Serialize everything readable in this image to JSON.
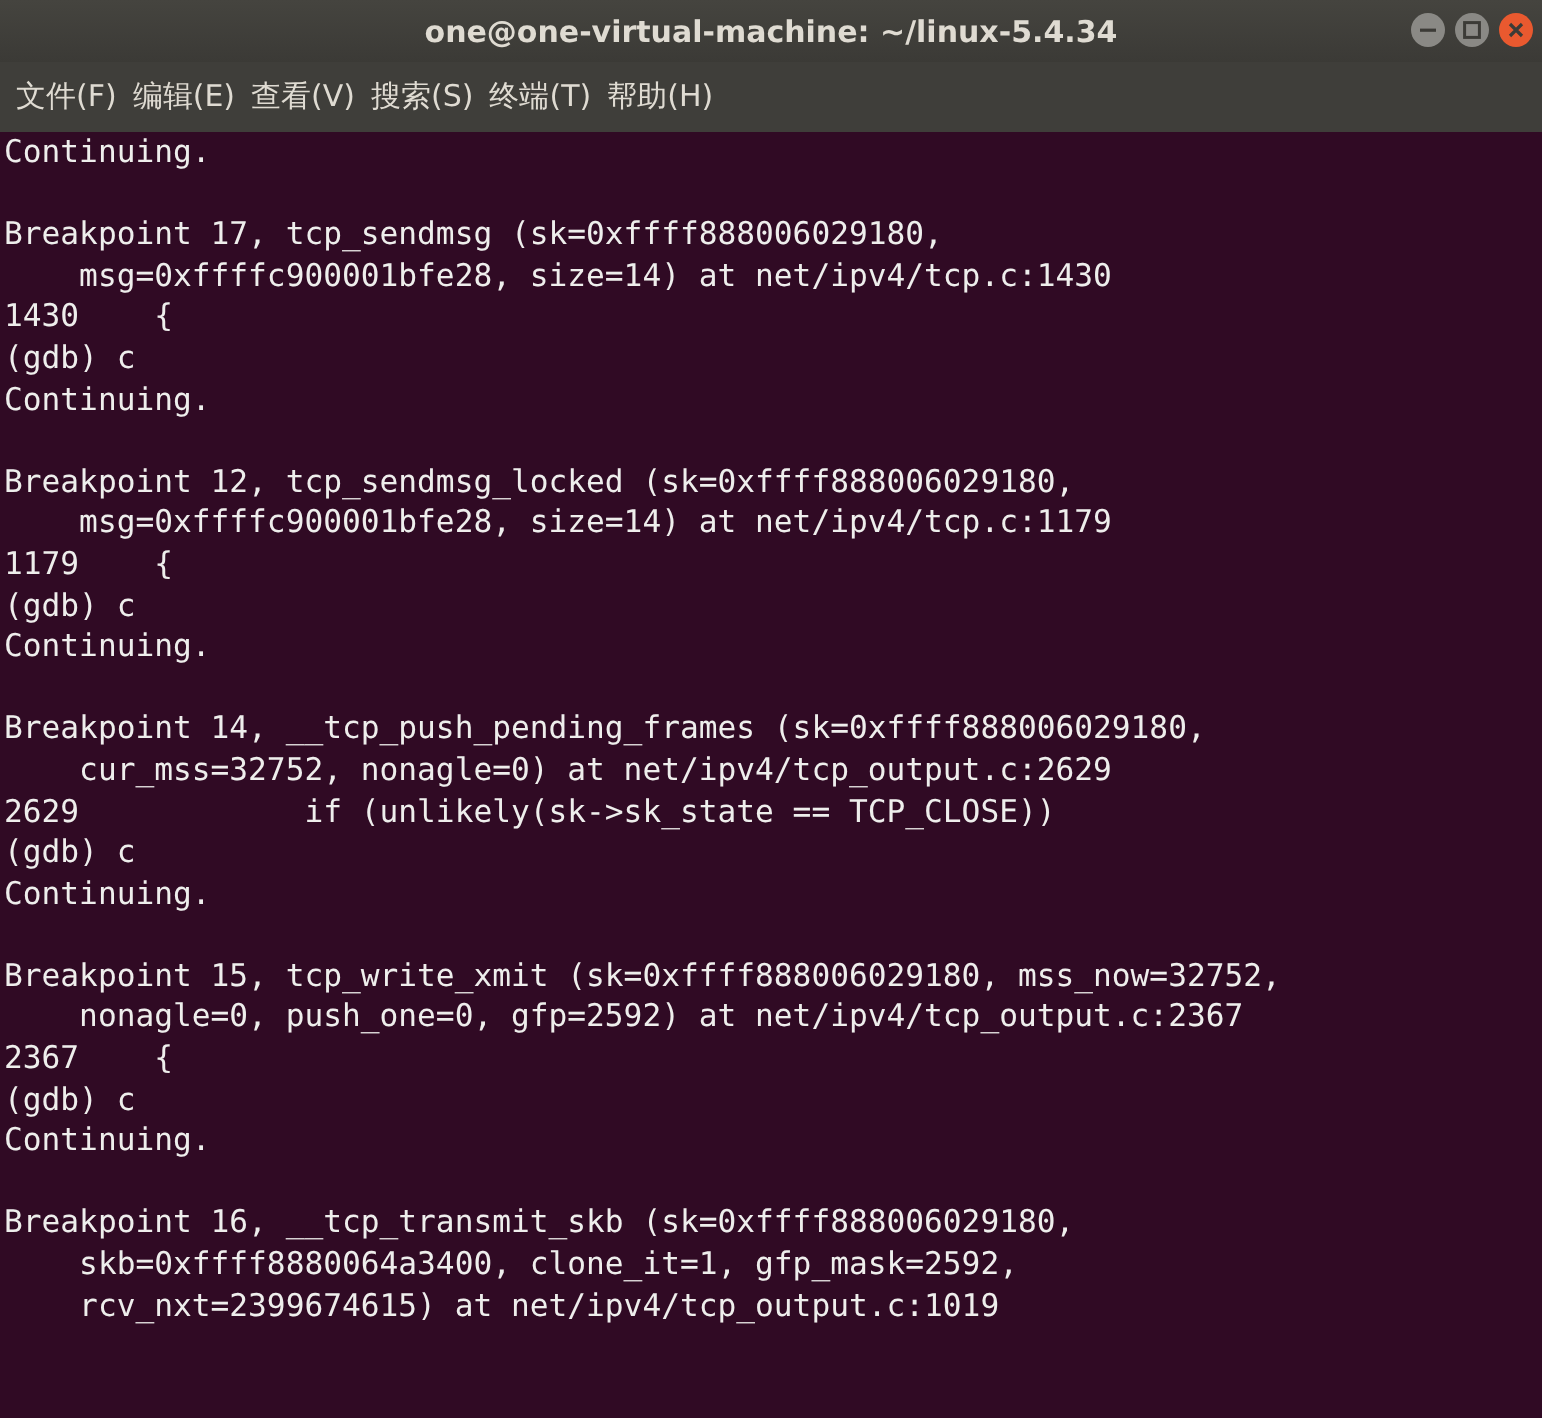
{
  "window": {
    "title": "one@one-virtual-machine: ~/linux-5.4.34"
  },
  "menu": [
    "文件(F)",
    "编辑(E)",
    "查看(V)",
    "搜索(S)",
    "终端(T)",
    "帮助(H)"
  ],
  "terminal": {
    "blocks": [
      {
        "lines": [
          "Continuing."
        ]
      },
      {
        "lines": [
          "Breakpoint 17, tcp_sendmsg (sk=0xffff888006029180,",
          "    msg=0xffffc900001bfe28, size=14) at net/ipv4/tcp.c:1430",
          "1430    {",
          "(gdb) c",
          "Continuing."
        ]
      },
      {
        "lines": [
          "Breakpoint 12, tcp_sendmsg_locked (sk=0xffff888006029180,",
          "    msg=0xffffc900001bfe28, size=14) at net/ipv4/tcp.c:1179",
          "1179    {",
          "(gdb) c",
          "Continuing."
        ]
      },
      {
        "lines": [
          "Breakpoint 14, __tcp_push_pending_frames (sk=0xffff888006029180,",
          "    cur_mss=32752, nonagle=0) at net/ipv4/tcp_output.c:2629",
          "2629            if (unlikely(sk->sk_state == TCP_CLOSE))",
          "(gdb) c",
          "Continuing."
        ]
      },
      {
        "lines": [
          "Breakpoint 15, tcp_write_xmit (sk=0xffff888006029180, mss_now=32752,",
          "    nonagle=0, push_one=0, gfp=2592) at net/ipv4/tcp_output.c:2367",
          "2367    {",
          "(gdb) c",
          "Continuing."
        ]
      },
      {
        "lines": [
          "Breakpoint 16, __tcp_transmit_skb (sk=0xffff888006029180,",
          "    skb=0xffff8880064a3400, clone_it=1, gfp_mask=2592,",
          "    rcv_nxt=2399674615) at net/ipv4/tcp_output.c:1019"
        ]
      }
    ]
  }
}
